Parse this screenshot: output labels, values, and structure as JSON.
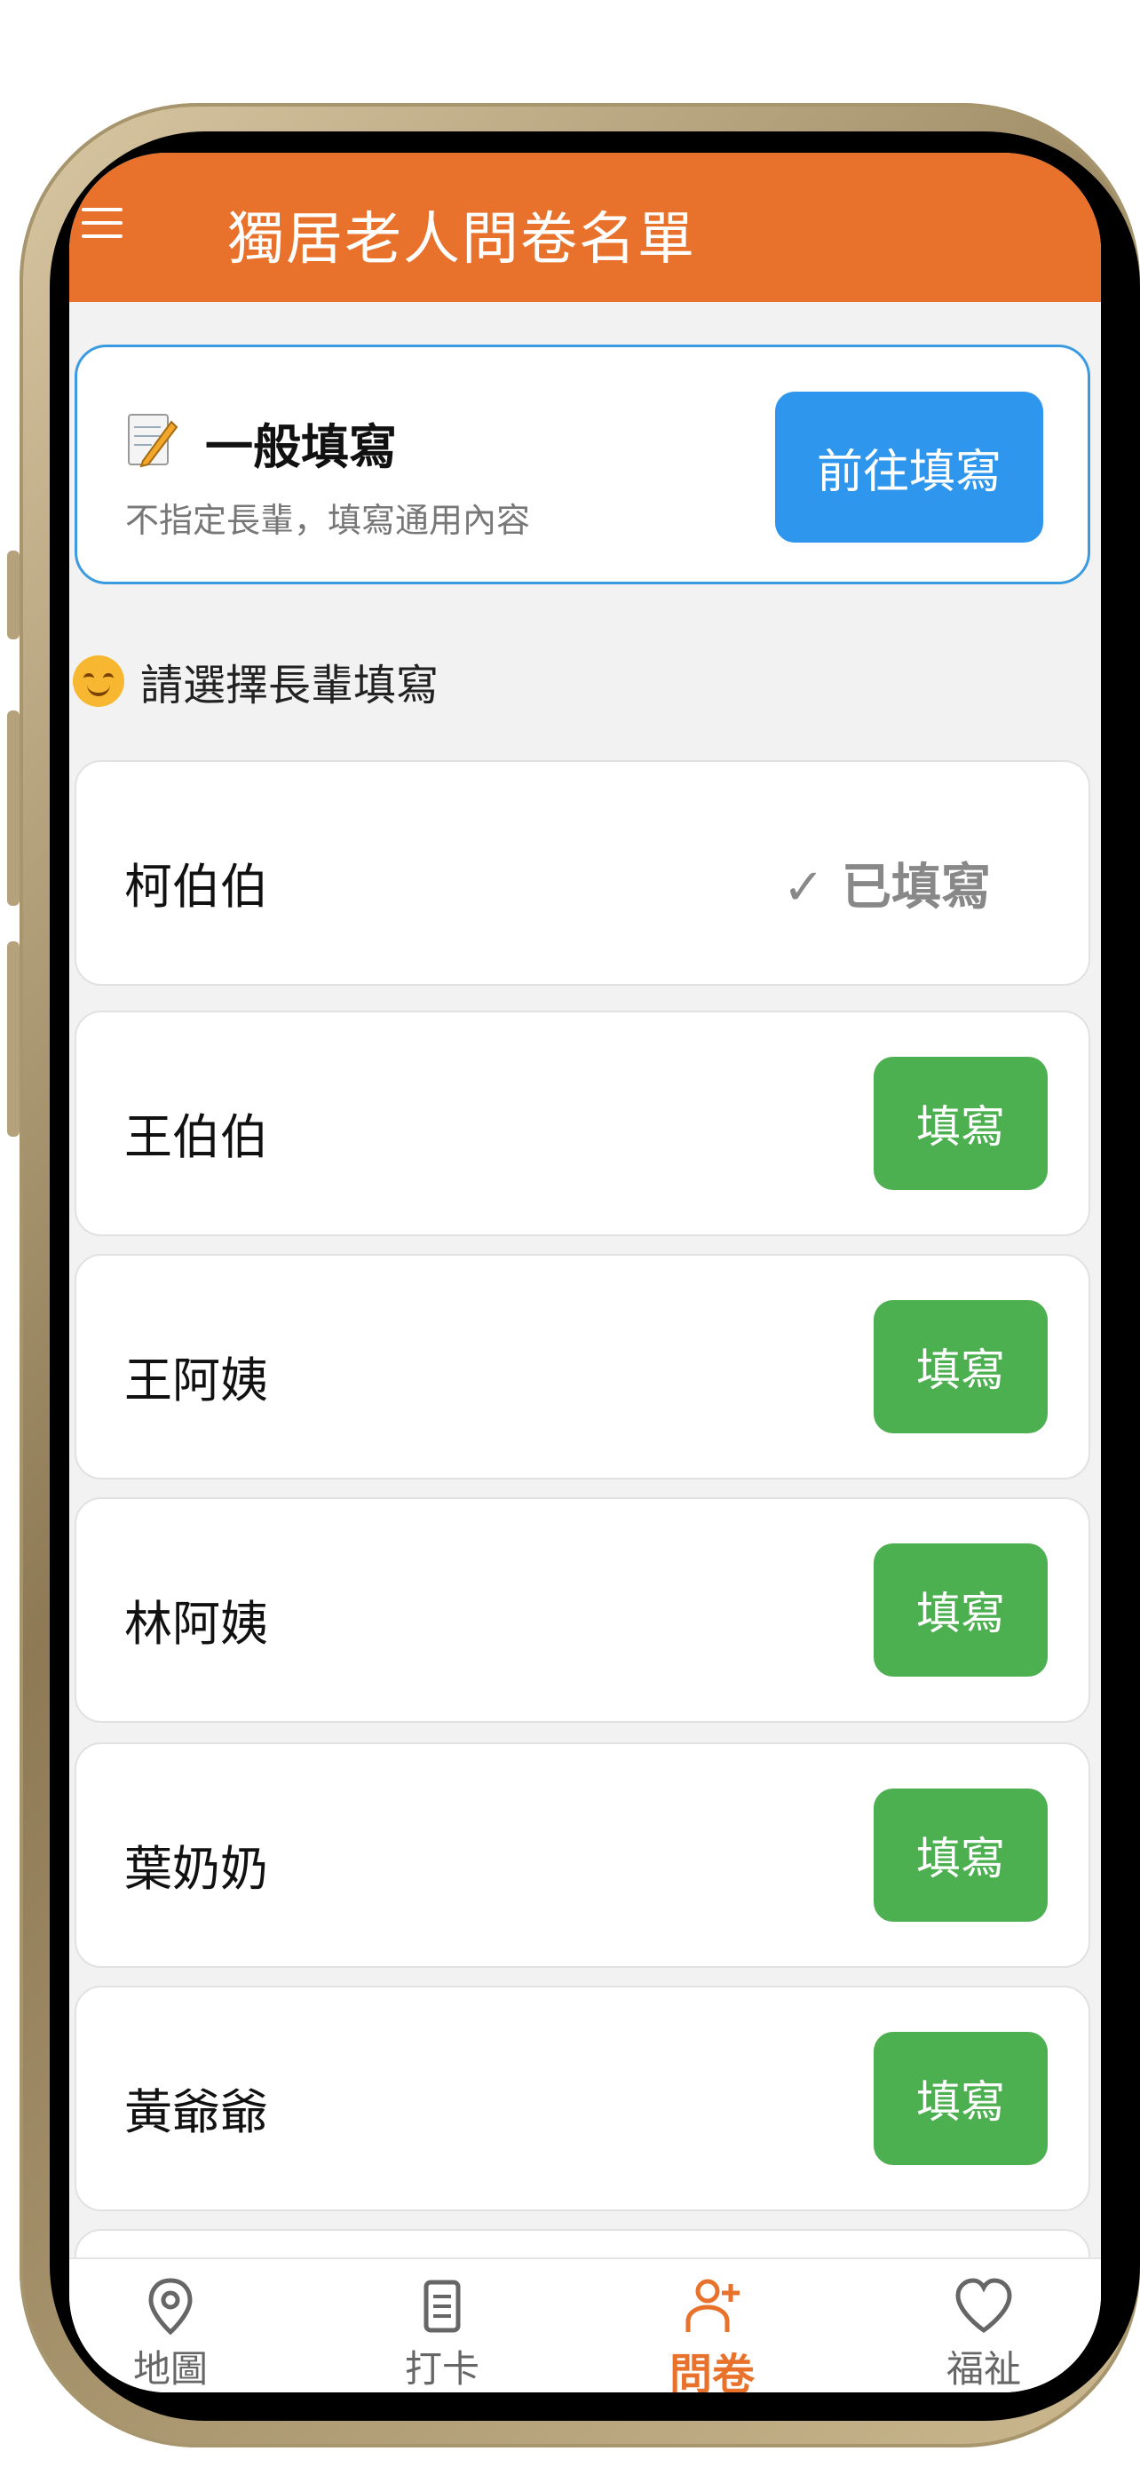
{
  "header": {
    "title": "獨居老人問卷名單"
  },
  "general": {
    "title": "一般填寫",
    "subtitle": "不指定長輩，填寫通用內容",
    "button": "前往填寫"
  },
  "section": {
    "title": "請選擇長輩填寫"
  },
  "rows": [
    {
      "name": "柯伯伯",
      "status": "✓ 已填寫"
    },
    {
      "name": "王伯伯",
      "button": "填寫"
    },
    {
      "name": "王阿姨",
      "button": "填寫"
    },
    {
      "name": "林阿姨",
      "button": "填寫"
    },
    {
      "name": "葉奶奶",
      "button": "填寫"
    },
    {
      "name": "黃爺爺",
      "button": "填寫"
    }
  ],
  "tabs": [
    {
      "label": "地圖",
      "icon": "map-pin-icon"
    },
    {
      "label": "打卡",
      "icon": "document-icon"
    },
    {
      "label": "問卷",
      "icon": "add-user-icon",
      "active": true
    },
    {
      "label": "福祉",
      "icon": "heart-icon"
    }
  ],
  "colors": {
    "accent": "#e8722b",
    "primary_button": "#2e96ec",
    "fill_button": "#4caf50"
  }
}
